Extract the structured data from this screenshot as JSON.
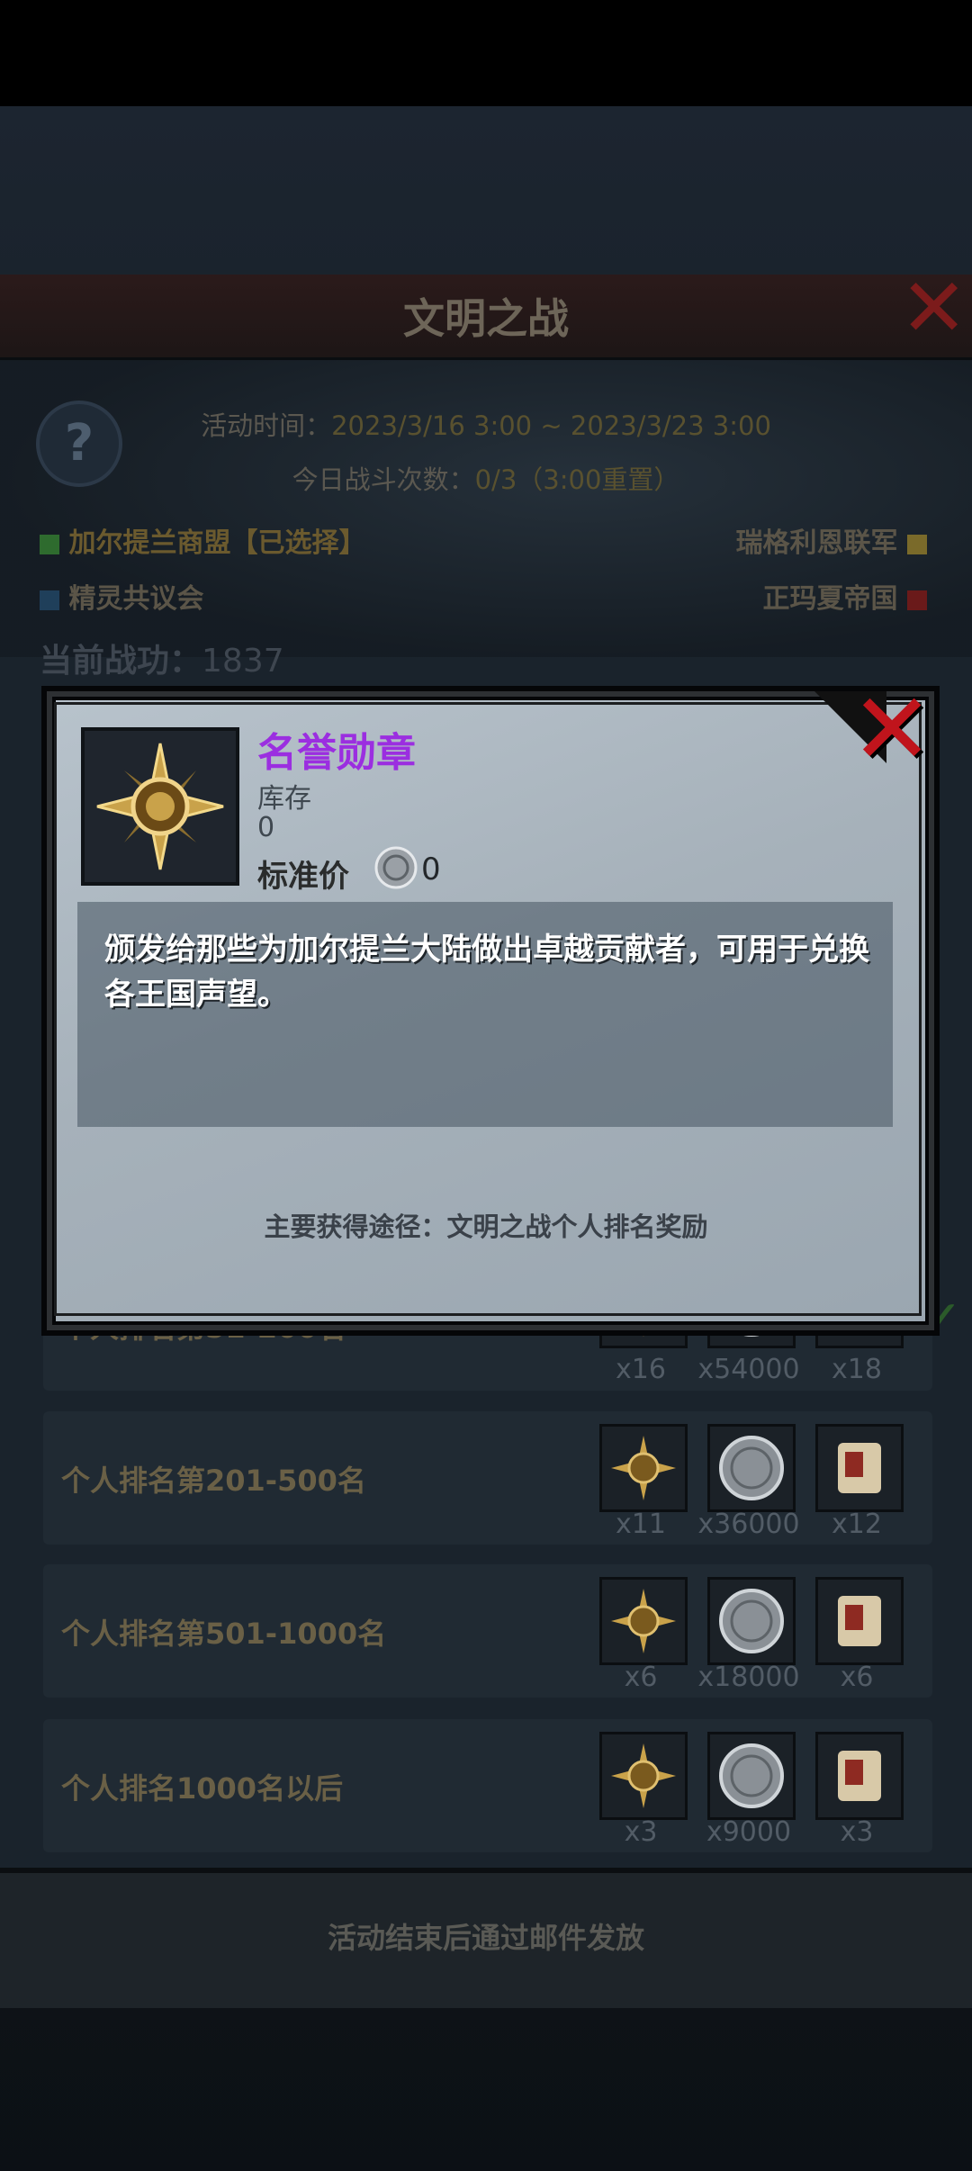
{
  "panel": {
    "title": "文明之战",
    "close_icon": "close-x-icon",
    "help_icon": "?",
    "time_label": "活动时间：",
    "time_value": "2023/3/16 3:00 ~ 2023/3/23 3:00",
    "count_label": "今日战斗次数：",
    "count_value": "0/3（3:00重置）",
    "factions": [
      {
        "name": "加尔提兰商盟【已选择】",
        "color": "#2e6b2e"
      },
      {
        "name": "瑞格利恩联军",
        "color": "#7a6a2a"
      },
      {
        "name": "精灵共议会",
        "color": "#1f3f5a"
      },
      {
        "name": "正玛夏帝国",
        "color": "#6a1a1a"
      }
    ],
    "merit_label": "当前战功：",
    "merit_value": "1837"
  },
  "rewards": [
    {
      "label": "个人排名第51-200名",
      "items": [
        {
          "icon": "medal-icon",
          "qty": "x16"
        },
        {
          "icon": "silver-coin-icon",
          "qty": "x54000"
        },
        {
          "icon": "scroll-icon",
          "qty": "x18"
        }
      ]
    },
    {
      "label": "个人排名第201-500名",
      "items": [
        {
          "icon": "medal-icon",
          "qty": "x11"
        },
        {
          "icon": "silver-coin-icon",
          "qty": "x36000"
        },
        {
          "icon": "scroll-icon",
          "qty": "x12"
        }
      ]
    },
    {
      "label": "个人排名第501-1000名",
      "items": [
        {
          "icon": "medal-icon",
          "qty": "x6"
        },
        {
          "icon": "silver-coin-icon",
          "qty": "x18000"
        },
        {
          "icon": "scroll-icon",
          "qty": "x6"
        }
      ]
    },
    {
      "label": "个人排名1000名以后",
      "items": [
        {
          "icon": "medal-icon",
          "qty": "x3"
        },
        {
          "icon": "silver-coin-icon",
          "qty": "x9000"
        },
        {
          "icon": "scroll-icon",
          "qty": "x3"
        }
      ]
    }
  ],
  "footer": {
    "text": "活动结束后通过邮件发放"
  },
  "modal": {
    "item_name": "名誉勋章",
    "stock_label": "库存",
    "stock_value": "0",
    "price_label": "标准价",
    "price_value": "0",
    "description": "颁发给那些为加尔提兰大陆做出卓越贡献者，可用于兑换各王国声望。",
    "source": "主要获得途径：文明之战个人排名奖励",
    "name_color": "#9b2ee0"
  }
}
